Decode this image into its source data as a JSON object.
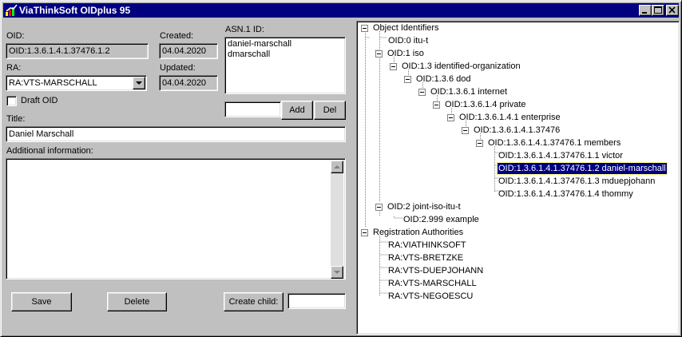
{
  "window": {
    "title": "ViaThinkSoft OIDplus 95"
  },
  "form": {
    "oid_label": "OID:",
    "oid_value": "OID:1.3.6.1.4.1.37476.1.2",
    "created_label": "Created:",
    "created_value": "04.04.2020",
    "updated_label": "Updated:",
    "updated_value": "04.04.2020",
    "asn1_label": "ASN.1 ID:",
    "asn1_ids": [
      "daniel-marschall",
      "dmarschall"
    ],
    "asn1_input": "",
    "add_label": "Add",
    "del_label": "Del",
    "ra_label": "RA:",
    "ra_value": "RA:VTS-MARSCHALL",
    "draft_label": "Draft OID",
    "title_label": "Title:",
    "title_value": "Daniel Marschall",
    "additional_label": "Additional information:",
    "additional_value": "",
    "save_label": "Save",
    "delete_label": "Delete",
    "create_child_label": "Create child:",
    "create_child_value": ""
  },
  "tree": {
    "nodes": [
      "Object Identifiers",
      "OID:0 itu-t",
      "OID:1 iso",
      "OID:1.3 identified-organization",
      "OID:1.3.6 dod",
      "OID:1.3.6.1 internet",
      "OID:1.3.6.1.4 private",
      "OID:1.3.6.1.4.1 enterprise",
      "OID:1.3.6.1.4.1.37476",
      "OID:1.3.6.1.4.1.37476.1 members",
      "OID:1.3.6.1.4.1.37476.1.1 victor",
      "OID:1.3.6.1.4.1.37476.1.2 daniel-marschall",
      "OID:1.3.6.1.4.1.37476.1.3 mduepjohann",
      "OID:1.3.6.1.4.1.37476.1.4 thommy",
      "OID:2 joint-iso-itu-t",
      "OID:2.999 example",
      "Registration Authorities",
      "RA:VIATHINKSOFT",
      "RA:VTS-BRETZKE",
      "RA:VTS-DUEPJOHANN",
      "RA:VTS-MARSCHALL",
      "RA:VTS-NEGOESCU"
    ],
    "selected": "OID:1.3.6.1.4.1.37476.1.2 daniel-marschall"
  }
}
